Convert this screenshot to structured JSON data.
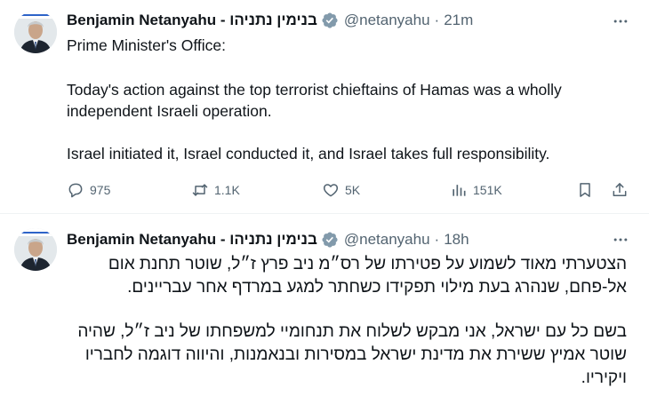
{
  "tweets": [
    {
      "author": {
        "display_name": "Benjamin Netanyahu - בנימין נתניהו",
        "handle": "@netanyahu",
        "separator": "·",
        "time": "21m",
        "verified": true
      },
      "paragraphs": [
        "Prime Minister's Office:",
        "Today's action against the top terrorist chieftains of Hamas was a wholly independent Israeli operation.",
        "Israel initiated it, Israel conducted it, and Israel takes full responsibility."
      ],
      "metrics": {
        "replies": "975",
        "reposts": "1.1K",
        "likes": "5K",
        "views": "151K"
      },
      "icons": [
        "reply-icon",
        "repost-icon",
        "like-icon",
        "views-icon",
        "bookmark-icon",
        "share-icon",
        "more-icon",
        "verified-badge-icon"
      ]
    },
    {
      "author": {
        "display_name": "Benjamin Netanyahu - בנימין נתניהו",
        "handle": "@netanyahu",
        "separator": "·",
        "time": "18h",
        "verified": true
      },
      "paragraphs": [
        "הצטערתי מאוד לשמוע על פטירתו של רס״מ ניב פרץ ז״ל, שוטר תחנת אום אל-פחם, שנהרג בעת מילוי תפקידו כשחתר למגע במרדף אחר עבריינים.",
        "בשם כל עם ישראל, אני מבקש לשלוח את תנחומיי למשפחתו של ניב ז״ל, שהיה שוטר אמיץ ששירת את מדינת ישראל במסירות ובנאמנות, והיווה דוגמה לחבריו ויקיריו."
      ]
    }
  ],
  "colors": {
    "text": "#0f1419",
    "secondary": "#536471",
    "verified": "#829aab",
    "divider": "#eff3f4"
  }
}
